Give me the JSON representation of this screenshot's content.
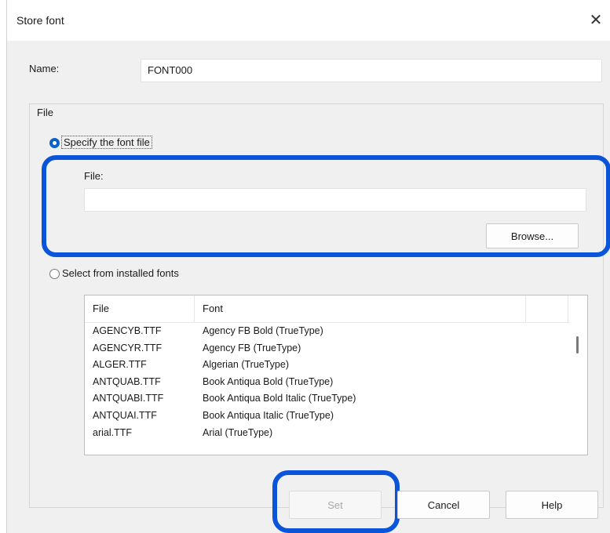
{
  "dialog": {
    "title": "Store font",
    "close_glyph": "✕"
  },
  "name": {
    "label": "Name:",
    "value": "FONT000"
  },
  "file_group": {
    "label": "File",
    "specify_radio_label": "Specify the font file",
    "specify_selected": true,
    "file_label": "File:",
    "file_value": "",
    "browse_label": "Browse...",
    "installed_radio_label": "Select from installed fonts",
    "installed_selected": false
  },
  "font_list": {
    "columns": [
      "File",
      "Font"
    ],
    "rows": [
      {
        "file": "AGENCYB.TTF",
        "font": "Agency FB Bold (TrueType)"
      },
      {
        "file": "AGENCYR.TTF",
        "font": "Agency FB (TrueType)"
      },
      {
        "file": "ALGER.TTF",
        "font": "Algerian (TrueType)"
      },
      {
        "file": "ANTQUAB.TTF",
        "font": "Book Antiqua Bold (TrueType)"
      },
      {
        "file": "ANTQUABI.TTF",
        "font": "Book Antiqua Bold Italic (TrueType)"
      },
      {
        "file": "ANTQUAI.TTF",
        "font": "Book Antiqua Italic (TrueType)"
      },
      {
        "file": "arial.TTF",
        "font": "Arial (TrueType)"
      }
    ]
  },
  "buttons": {
    "set": "Set",
    "cancel": "Cancel",
    "help": "Help"
  },
  "colors": {
    "highlight": "#0a54d9",
    "radio_selected": "#0a64c8"
  }
}
